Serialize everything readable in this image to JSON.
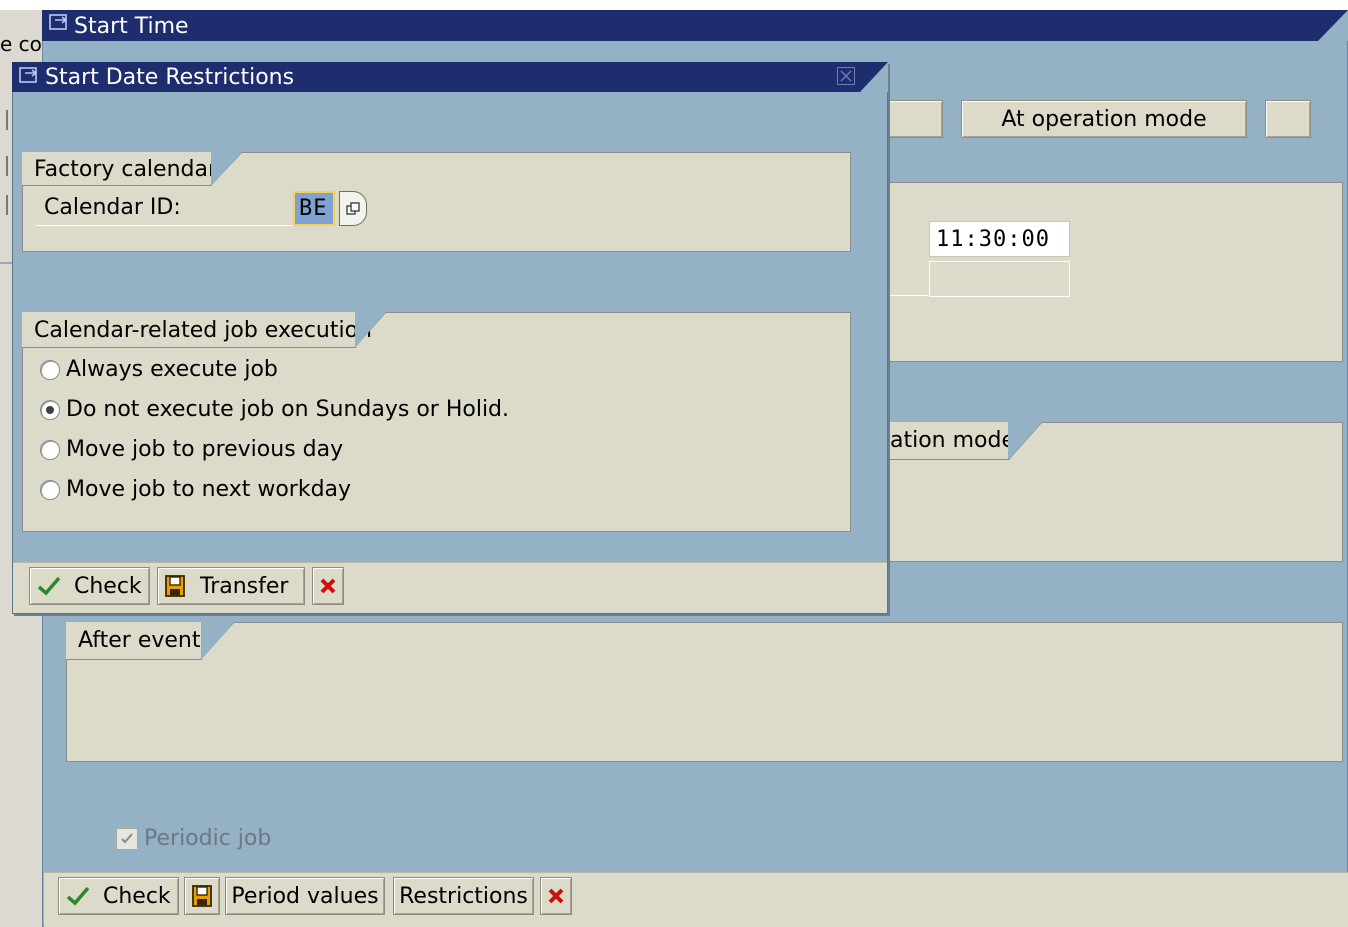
{
  "background_window": {
    "fragment_text": "e co"
  },
  "main_window": {
    "title": "Start Time",
    "title_icon": "window-icon",
    "buttons": {
      "partial_left_label": "",
      "operation_mode_label": "At operation mode",
      "partial_right_label": ""
    },
    "date_time": {
      "time_value": "11:30:00",
      "second_value": ""
    },
    "operation_mode_group_title_partial": "ation mode",
    "after_event_group_title": "After event",
    "periodic_job": {
      "label": "Periodic job",
      "checked": true,
      "enabled": false
    },
    "toolbar": {
      "check_label": "Check",
      "period_values_label": "Period values",
      "restrictions_label": "Restrictions",
      "save_icon": "save-icon",
      "cancel_icon": "cancel-icon"
    }
  },
  "dialog": {
    "title": "Start Date Restrictions",
    "close_icon": "close-icon",
    "factory_calendar": {
      "group_title": "Factory calendar",
      "calendar_id_label": "Calendar ID:",
      "calendar_id_value": "BE",
      "value_help_icon": "value-help-icon"
    },
    "job_execution": {
      "group_title": "Calendar-related job execution",
      "options": [
        {
          "label": "Always execute job",
          "selected": false
        },
        {
          "label": "Do not execute job on Sundays or Holid.",
          "selected": true
        },
        {
          "label": "Move job to previous day",
          "selected": false
        },
        {
          "label": "Move job to next workday",
          "selected": false
        }
      ]
    },
    "toolbar": {
      "check_label": "Check",
      "transfer_label": "Transfer",
      "cancel_icon": "cancel-icon"
    }
  },
  "colors": {
    "title_bar": "#1d2d6e",
    "window_bg": "#94b1c6",
    "group_bg": "#dcdac8",
    "check_green": "#2a8a2a",
    "cancel_red": "#cc1010"
  }
}
